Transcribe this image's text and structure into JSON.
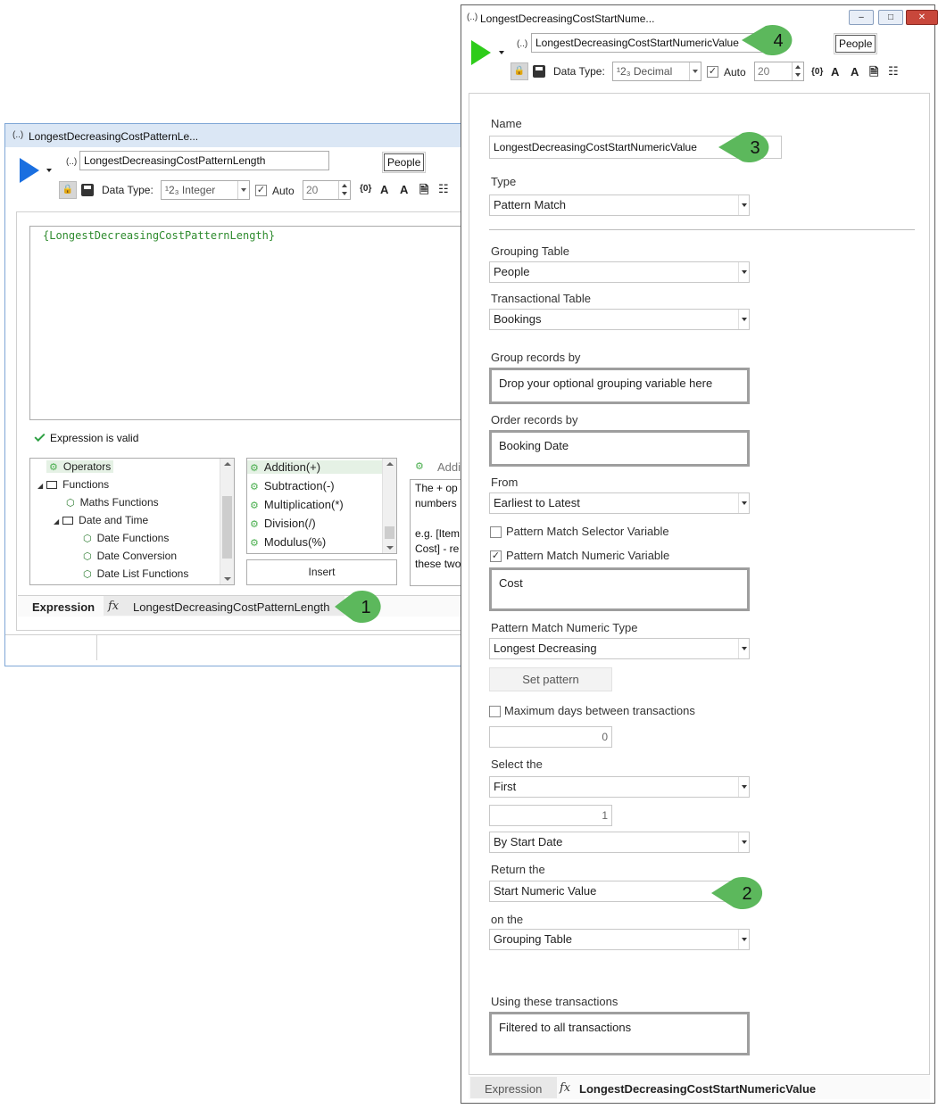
{
  "left_window": {
    "title": "LongestDecreasingCostPatternLe...",
    "title_glyph": "(..)",
    "name_glyph": "(..)",
    "name_value": "LongestDecreasingCostPatternLength",
    "people_label": "People",
    "data_type_label": "Data Type:",
    "data_type_value": "¹2₃ Integer",
    "auto_label": "Auto",
    "auto_checked": "✓",
    "size_value": "20",
    "expression_text": "{LongestDecreasingCostPatternLength}",
    "valid_text": "Expression is valid",
    "tree": [
      {
        "label": "Operators"
      },
      {
        "label": "Functions"
      },
      {
        "label": "Maths Functions"
      },
      {
        "label": "Date and Time"
      },
      {
        "label": "Date Functions"
      },
      {
        "label": "Date Conversion"
      },
      {
        "label": "Date List Functions"
      }
    ],
    "functions": [
      {
        "label": "Addition(+)"
      },
      {
        "label": "Subtraction(-)"
      },
      {
        "label": "Multiplication(*)"
      },
      {
        "label": "Division(/)"
      },
      {
        "label": "Modulus(%)"
      }
    ],
    "insert_label": "Insert",
    "desc_header": "Addi",
    "desc_lines": [
      "The + op",
      "numbers",
      "",
      "e.g. [Item",
      "Cost] - re",
      "these two"
    ],
    "tab_expression": "Expression",
    "tab_fx": "fx",
    "tab_name": "LongestDecreasingCostPatternLength"
  },
  "right_window": {
    "title": "LongestDecreasingCostStartNume...",
    "title_glyph": "(..)",
    "name_glyph": "(..)",
    "name_value": "LongestDecreasingCostStartNumericValue",
    "people_label": "People",
    "data_type_label": "Data Type:",
    "data_type_value": "¹2₃ Decimal",
    "auto_label": "Auto",
    "auto_checked": "✓",
    "size_value": "20",
    "form": {
      "name_label": "Name",
      "name_value": "LongestDecreasingCostStartNumericValue",
      "type_label": "Type",
      "type_value": "Pattern Match",
      "grouping_table_label": "Grouping Table",
      "grouping_table_value": "People",
      "transactional_table_label": "Transactional Table",
      "transactional_table_value": "Bookings",
      "group_records_label": "Group records by",
      "group_records_value": "Drop your optional grouping variable here",
      "order_records_label": "Order records by",
      "order_records_value": "Booking Date",
      "from_label": "From",
      "from_value": "Earliest to Latest",
      "selector_variable_label": "Pattern Match Selector Variable",
      "numeric_variable_label": "Pattern Match Numeric Variable",
      "numeric_variable_checked": "✓",
      "numeric_variable_value": "Cost",
      "numeric_type_label": "Pattern Match Numeric Type",
      "numeric_type_value": "Longest Decreasing",
      "set_pattern_label": "Set pattern",
      "max_days_label": "Maximum days between transactions",
      "max_days_value": "0",
      "select_the_label": "Select the",
      "select_the_value": "First",
      "select_count_value": "1",
      "by_value": "By Start Date",
      "return_the_label": "Return the",
      "return_the_value": "Start Numeric Value",
      "on_the_label": "on the",
      "on_the_value": "Grouping Table",
      "using_label": "Using these transactions",
      "using_value": "Filtered to all transactions"
    },
    "tab_expression": "Expression",
    "tab_fx": "fx",
    "tab_name": "LongestDecreasingCostStartNumericValue"
  },
  "callouts": [
    {
      "number": "1"
    },
    {
      "number": "2"
    },
    {
      "number": "3"
    },
    {
      "number": "4"
    }
  ],
  "colors": {
    "callout_fill": "#5cb85c",
    "play_blue": "#1a6fe0",
    "play_green": "#2ecc1a",
    "expression_green": "#2e8b2e"
  }
}
